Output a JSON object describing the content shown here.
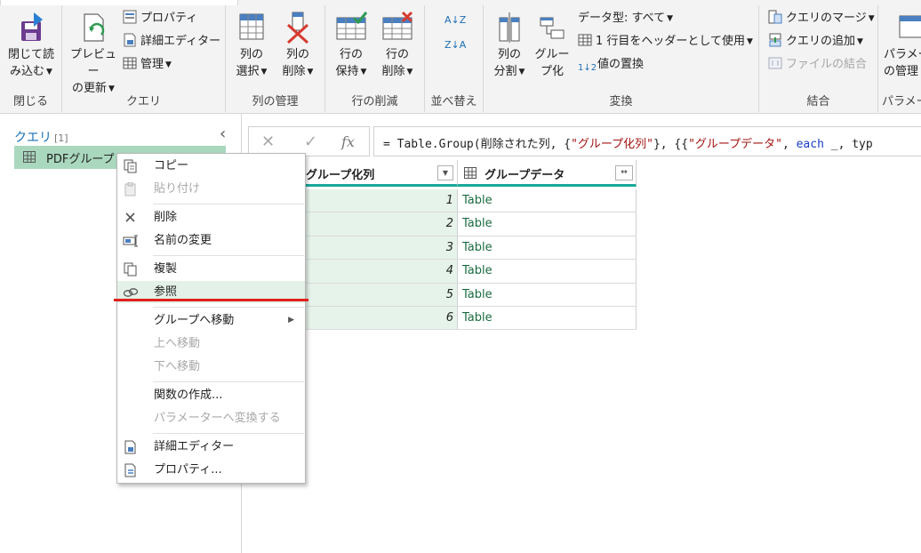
{
  "ribbon": {
    "groups": {
      "close": {
        "title": "閉じる",
        "close_load": {
          "line1": "閉じて読",
          "line2": "み込む"
        }
      },
      "query": {
        "title": "クエリ",
        "refresh": {
          "line1": "プレビュー",
          "line2": "の更新"
        },
        "properties": "プロパティ",
        "advanced_editor": "詳細エディター",
        "manage": "管理"
      },
      "manage_columns": {
        "title": "列の管理",
        "choose": {
          "line1": "列の",
          "line2": "選択"
        },
        "remove": {
          "line1": "列の",
          "line2": "削除"
        }
      },
      "reduce_rows": {
        "title": "行の削減",
        "keep": {
          "line1": "行の",
          "line2": "保持"
        },
        "remove": {
          "line1": "行の",
          "line2": "削除"
        }
      },
      "sort": {
        "title": "並べ替え",
        "asc_label": "A↓Z",
        "desc_label": "Z↓A"
      },
      "transform": {
        "title": "変換",
        "split": {
          "line1": "列の",
          "line2": "分割"
        },
        "group": {
          "line1": "グルー",
          "line2": "プ化"
        },
        "data_type": "データ型: すべて",
        "first_row_header": "1 行目をヘッダーとして使用",
        "replace_values": "値の置換",
        "replace_prefix": "1↓2"
      },
      "combine": {
        "title": "結合",
        "merge": "クエリのマージ",
        "append": "クエリの追加",
        "combine_files": "ファイルの結合"
      },
      "params": {
        "title": "パラメー",
        "manage": {
          "line1": "パラメー",
          "line2": "の管理"
        }
      }
    }
  },
  "querypane": {
    "title": "クエリ",
    "count": "[1]",
    "collapse": "‹",
    "item": "PDFグループ"
  },
  "formula": {
    "cancel": "✕",
    "commit": "✓",
    "fx": "fx",
    "p1": "= Table.Group(削除された列, {",
    "s1": "\"グループ化列\"",
    "p2": "}, {{",
    "s2": "\"グループデータ\"",
    "p3": ", ",
    "k1": "each",
    "p4": " _, typ"
  },
  "grid": {
    "headers": [
      "グループ化列",
      "グループデータ"
    ],
    "rows": [
      {
        "n": "1",
        "v": "Table"
      },
      {
        "n": "2",
        "v": "Table"
      },
      {
        "n": "3",
        "v": "Table"
      },
      {
        "n": "4",
        "v": "Table"
      },
      {
        "n": "5",
        "v": "Table"
      },
      {
        "n": "6",
        "v": "Table"
      }
    ]
  },
  "context_menu": {
    "copy": "コピー",
    "paste": "貼り付け",
    "delete": "削除",
    "rename": "名前の変更",
    "duplicate": "複製",
    "reference": "参照",
    "move_to_group": "グループへ移動",
    "move_up": "上へ移動",
    "move_down": "下へ移動",
    "create_function": "関数の作成...",
    "convert_to_param": "パラメーターへ変換する",
    "advanced_editor": "詳細エディター",
    "properties": "プロパティ..."
  },
  "colors": {
    "accent_teal": "#19a89a",
    "selected_green": "#a9d8be",
    "highlight_red": "#e0201c",
    "link_blue": "#1c6fb5"
  }
}
